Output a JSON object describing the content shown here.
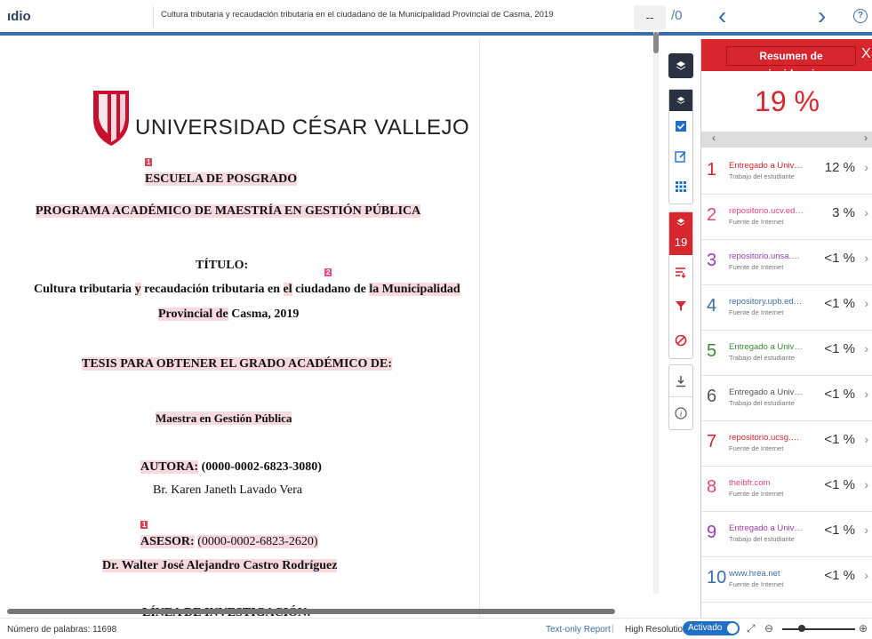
{
  "header": {
    "brand": "ıdio",
    "doc_title": "Cultura tributaria y recaudación tributaria en el ciudadano de la Municipalidad Provincial de Casma, 2019",
    "page_current": "--",
    "page_total": "/0",
    "prev": "‹",
    "next": "›",
    "help": "?"
  },
  "document": {
    "university": "UNIVERSIDAD CÉSAR VALLEJO",
    "school": "ESCUELA DE POSGRADO",
    "program": "PROGRAMA ACADÉMICO DE MAESTRÍA EN GESTIÓN PÚBLICA",
    "titulo_label": "TÍTULO:",
    "title_line1_a": "Cultura tributaria",
    "title_line1_y": "y",
    "title_line1_b": "recaudación tributaria en",
    "title_line1_el": "el",
    "title_line1_c": "ciudadano de",
    "title_line1_la": "la Municipalidad",
    "title_line2_a": "Provincial de",
    "title_line2_b": "Casma, 2019",
    "tesis": "TESIS PARA OBTENER EL GRADO ACADÉMICO DE:",
    "degree": "Maestra en Gestión Pública",
    "autora_label": "AUTORA:",
    "autora_orcid": "(0000-0002-6823-3080)",
    "autora_name": "Br. Karen Janeth Lavado Vera",
    "asesor_label": "ASESOR:",
    "asesor_orcid": "(0000-0002-6823-2620)",
    "asesor_name": "Dr. Walter José Alejandro Castro Rodríguez",
    "linea": "LÍNEA DE INVESTIGACIÓN:",
    "marker1": "1",
    "marker2": "2"
  },
  "toolbar": {
    "match_count": "19"
  },
  "sidebar": {
    "title": "Resumen de coincidencias",
    "close": "X",
    "overall": "19 %",
    "items": [
      {
        "n": "1",
        "source": "Entregado a Universida...",
        "type": "Trabajo del estudiante",
        "pct": "12 %",
        "color": "#d7262e"
      },
      {
        "n": "2",
        "source": "repositorio.ucv.edu.pe",
        "type": "Fuente de Internet",
        "pct": "3 %",
        "color": "#e0457b"
      },
      {
        "n": "3",
        "source": "repositorio.unsa.edu.pe",
        "type": "Fuente de Internet",
        "pct": "<1 %",
        "color": "#9b3fb0"
      },
      {
        "n": "4",
        "source": "repository.upb.edu.co",
        "type": "Fuente de Internet",
        "pct": "<1 %",
        "color": "#3a6ea8"
      },
      {
        "n": "5",
        "source": "Entregado a Universida...",
        "type": "Trabajo del estudiante",
        "pct": "<1 %",
        "color": "#3c8a3a"
      },
      {
        "n": "6",
        "source": "Entregado a Universida...",
        "type": "Trabajo del estudiante",
        "pct": "<1 %",
        "color": "#555555"
      },
      {
        "n": "7",
        "source": "repositorio.ucsg.edu.ec",
        "type": "Fuente de Internet",
        "pct": "<1 %",
        "color": "#d7262e"
      },
      {
        "n": "8",
        "source": "theibfr.com",
        "type": "Fuente de Internet",
        "pct": "<1 %",
        "color": "#e0457b"
      },
      {
        "n": "9",
        "source": "Entregado a Universida...",
        "type": "Trabajo del estudiante",
        "pct": "<1 %",
        "color": "#9b3fb0"
      },
      {
        "n": "10",
        "source": "www.hrea.net",
        "type": "Fuente de Internet",
        "pct": "<1 %",
        "color": "#3a6ea8"
      }
    ]
  },
  "footer": {
    "word_count": "Número de palabras: 11698",
    "text_only": "Text-only Report",
    "sep": "|",
    "high_res": "High Resolution",
    "toggle": "Activado"
  }
}
